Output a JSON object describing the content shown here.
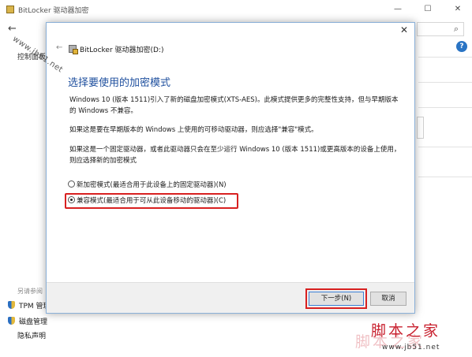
{
  "background_window": {
    "title": "BitLocker 驱动器加密",
    "minimize_label": "—",
    "maximize_label": "☐",
    "close_label": "✕",
    "back_label": "←",
    "search_icon": "⌕",
    "help_icon": "?",
    "sidebar_title": "控制面板",
    "see_also": {
      "title": "另请参阅",
      "items": [
        {
          "label": "TPM 管理"
        },
        {
          "label": "磁盘管理"
        },
        {
          "label": "隐私声明"
        }
      ]
    }
  },
  "dialog": {
    "close_label": "✕",
    "back_label": "←",
    "title": "BitLocker 驱动器加密(D:)",
    "heading": "选择要使用的加密模式",
    "paragraph1": "Windows 10 (版本 1511)引入了新的磁盘加密模式(XTS-AES)。此模式提供更多的完整性支持，但与早期版本的 Windows 不兼容。",
    "paragraph2": "如果这是要在早期版本的 Windows 上使用的可移动驱动器，则应选择\"兼容\"模式。",
    "paragraph3": "如果这是一个固定驱动器，或者此驱动器只会在至少运行 Windows 10 (版本 1511)或更高版本的设备上使用，则应选择新的加密模式",
    "options": [
      {
        "label": "新加密模式(最适合用于此设备上的固定驱动器)(N)",
        "selected": false
      },
      {
        "label": "兼容模式(最适合用于可从此设备移动的驱动器)(C)",
        "selected": true
      }
    ],
    "next_button": "下一步(N)",
    "cancel_button": "取消"
  },
  "watermarks": {
    "diagonal": "www.jb51.net",
    "logo": "脚本之家",
    "url": "www.jb51.net"
  },
  "colors": {
    "heading": "#1e4f9e",
    "highlight": "#d82020",
    "logo": "#c8202e"
  }
}
